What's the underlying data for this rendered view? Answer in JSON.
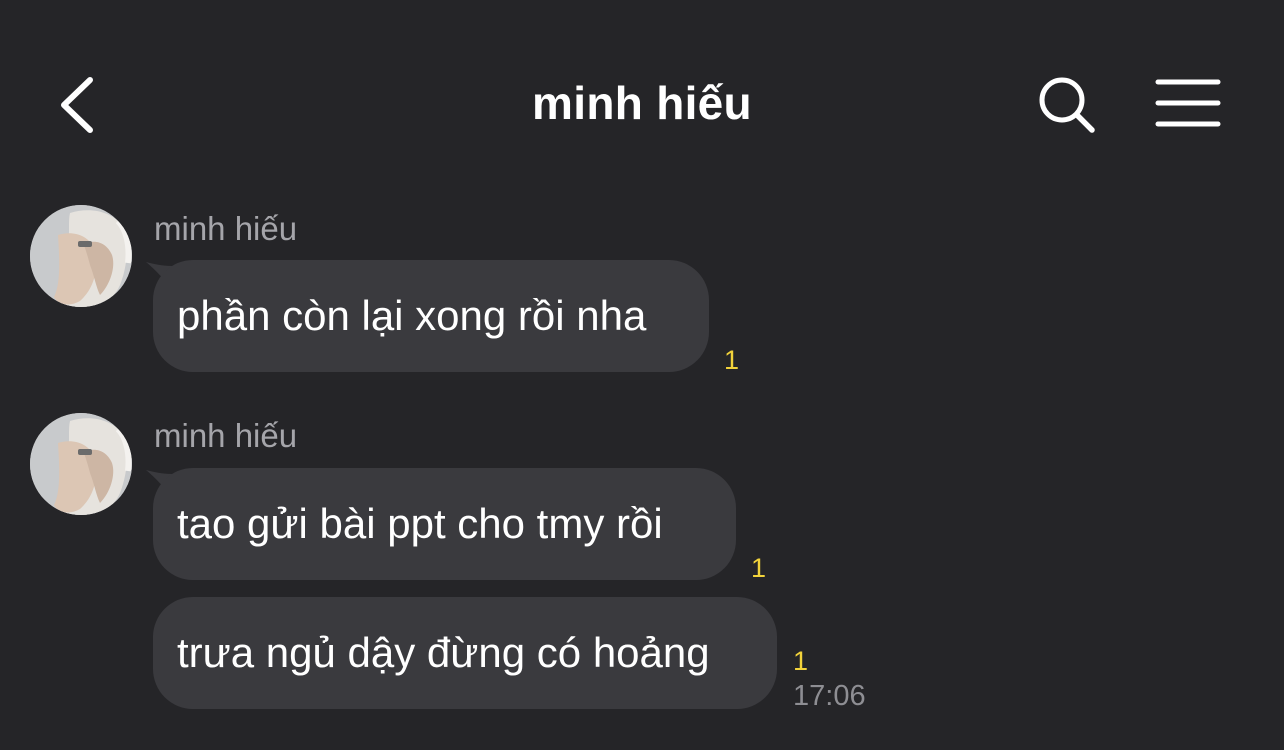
{
  "header": {
    "title": "minh hiếu"
  },
  "messages": [
    {
      "sender": "minh hiếu",
      "text": "phần còn lại xong rồi nha",
      "unread": "1"
    },
    {
      "sender": "minh hiếu",
      "text": "tao gửi bài ppt cho tmy rồi",
      "unread": "1"
    },
    {
      "text": "trưa ngủ dậy đừng có hoảng",
      "unread": "1",
      "time": "17:06"
    }
  ],
  "colors": {
    "background": "#252528",
    "bubble": "#3a3a3e",
    "unread": "#f2d33b",
    "secondary_text": "#a5a5aa"
  },
  "icons": [
    "back-chevron-icon",
    "search-icon",
    "menu-icon"
  ]
}
